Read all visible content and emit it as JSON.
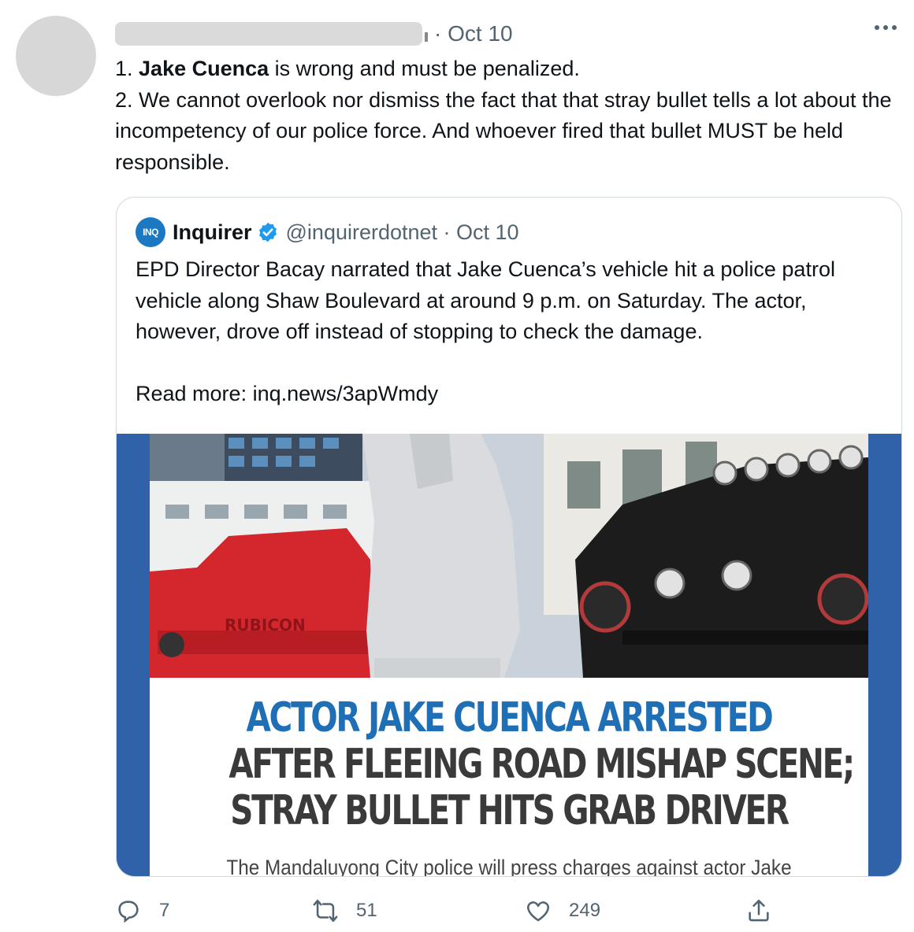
{
  "tweet": {
    "time": "· Oct 10",
    "lines": [
      {
        "prefix": "1. ",
        "bold": "Jake Cuenca",
        "rest": " is wrong and must be penalized."
      },
      {
        "text": "2. We cannot overlook nor dismiss the fact that that stray bullet tells a lot about the incompetency of our police force. And whoever fired that bullet MUST be held responsible."
      }
    ]
  },
  "quote": {
    "logo_text": "INQ",
    "name": "Inquirer",
    "handle": "@inquirerdotnet · Oct 10",
    "text": "EPD Director Bacay narrated that Jake Cuenca’s vehicle hit a police patrol vehicle along Shaw Boulevard at around 9 p.m. on Saturday. The actor, however, drove off instead of stopping to check the damage.",
    "read_more": "Read more: inq.news/3apWmdy",
    "media": {
      "headline_1": "ACTOR JAKE CUENCA ARRESTED",
      "headline_2": "AFTER FLEEING ROAD MISHAP SCENE;",
      "headline_3": "STRAY BULLET HITS GRAB DRIVER",
      "subline": "The Mandaluyong City police will press charges against actor Jake",
      "vehicle_text": "RUBICON"
    }
  },
  "actions": {
    "reply_count": "7",
    "retweet_count": "51",
    "like_count": "249"
  },
  "colors": {
    "accent_blue": "#1d9bf0",
    "muted": "#536471",
    "headline_blue": "#1f6fb6"
  }
}
